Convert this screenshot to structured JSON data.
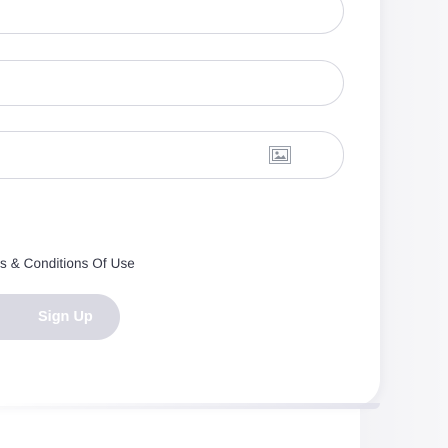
{
  "form": {
    "fields": [
      {
        "name": "field-1",
        "value": "",
        "placeholder": ""
      },
      {
        "name": "field-2",
        "value": "",
        "placeholder": ""
      },
      {
        "name": "field-3",
        "value": "",
        "placeholder": ""
      }
    ],
    "captcha_icon": "image-placeholder-icon",
    "terms_text": "s & Conditions Of Use",
    "signup_label": "Sign Up"
  },
  "colors": {
    "field_border": "#d6d7df",
    "button_bg": "#d9d9e2",
    "button_text": "#ffffff",
    "text": "#333645",
    "side_panel": "#f3f3f6"
  }
}
